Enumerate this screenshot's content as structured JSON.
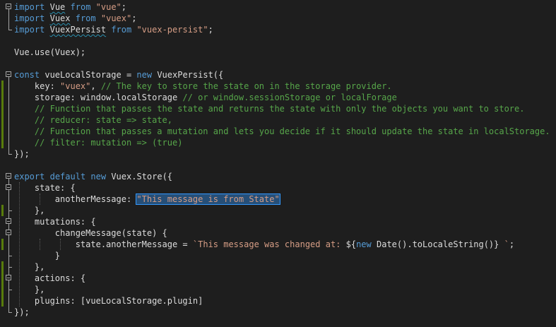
{
  "editor": {
    "language": "javascript",
    "lines": [
      [
        {
          "t": "import",
          "c": "kw"
        },
        {
          "t": " "
        },
        {
          "t": "Vue",
          "c": "id squig"
        },
        {
          "t": " "
        },
        {
          "t": "from",
          "c": "kw"
        },
        {
          "t": " "
        },
        {
          "t": "\"vue\"",
          "c": "str"
        },
        {
          "t": ";"
        }
      ],
      [
        {
          "t": "import",
          "c": "kw"
        },
        {
          "t": " "
        },
        {
          "t": "Vuex",
          "c": "id squig"
        },
        {
          "t": " "
        },
        {
          "t": "from",
          "c": "kw"
        },
        {
          "t": " "
        },
        {
          "t": "\"vuex\"",
          "c": "str"
        },
        {
          "t": ";"
        }
      ],
      [
        {
          "t": "import",
          "c": "kw"
        },
        {
          "t": " "
        },
        {
          "t": "VuexPersist",
          "c": "id squig"
        },
        {
          "t": " "
        },
        {
          "t": "from",
          "c": "kw"
        },
        {
          "t": " "
        },
        {
          "t": "\"vuex-persist\"",
          "c": "str"
        },
        {
          "t": ";"
        }
      ],
      [],
      [
        {
          "t": "Vue.use(Vuex);"
        }
      ],
      [],
      [
        {
          "t": "const",
          "c": "kw"
        },
        {
          "t": " vueLocalStorage = "
        },
        {
          "t": "new",
          "c": "kw"
        },
        {
          "t": " VuexPersist({"
        }
      ],
      [
        {
          "t": "    key: "
        },
        {
          "t": "\"vuex\"",
          "c": "str"
        },
        {
          "t": ", "
        },
        {
          "t": "// The key to store the state on in the storage provider.",
          "c": "cm"
        }
      ],
      [
        {
          "t": "    storage: window.localStorage "
        },
        {
          "t": "// or window.sessionStorage or localForage",
          "c": "cm"
        }
      ],
      [
        {
          "t": "    // Function that passes the state and returns the state with only the objects you want to store.",
          "c": "cm"
        }
      ],
      [
        {
          "t": "    // reducer: state => state,",
          "c": "cm"
        }
      ],
      [
        {
          "t": "    // Function that passes a mutation and lets you decide if it should update the state in localStorage.",
          "c": "cm"
        }
      ],
      [
        {
          "t": "    // filter: mutation => (true)",
          "c": "cm"
        }
      ],
      [
        {
          "t": "});"
        }
      ],
      [],
      [
        {
          "t": "export",
          "c": "kw"
        },
        {
          "t": " "
        },
        {
          "t": "default",
          "c": "kw"
        },
        {
          "t": " "
        },
        {
          "t": "new",
          "c": "kw"
        },
        {
          "t": " Vuex.Store({"
        }
      ],
      [
        {
          "t": "    state: {"
        }
      ],
      [
        {
          "t": "        anotherMessage: "
        },
        {
          "t": "\"This message is from State\"",
          "c": "str sel"
        }
      ],
      [
        {
          "t": "    },"
        }
      ],
      [
        {
          "t": "    mutations: {"
        }
      ],
      [
        {
          "t": "        changeMessage(state) {"
        }
      ],
      [
        {
          "t": "            state.anotherMessage = "
        },
        {
          "t": "`This message was changed at: ",
          "c": "str"
        },
        {
          "t": "${"
        },
        {
          "t": "new",
          "c": "kw"
        },
        {
          "t": " Date().toLocaleString()"
        },
        {
          "t": "}"
        },
        {
          "t": " `",
          "c": "str"
        },
        {
          "t": ";"
        }
      ],
      [
        {
          "t": "        }"
        }
      ],
      [
        {
          "t": "    },"
        }
      ],
      [
        {
          "t": "    actions: {"
        }
      ],
      [
        {
          "t": "    },"
        }
      ],
      [
        {
          "t": "    plugins: [vueLocalStorage.plugin]"
        }
      ],
      [
        {
          "t": "});"
        }
      ]
    ]
  }
}
